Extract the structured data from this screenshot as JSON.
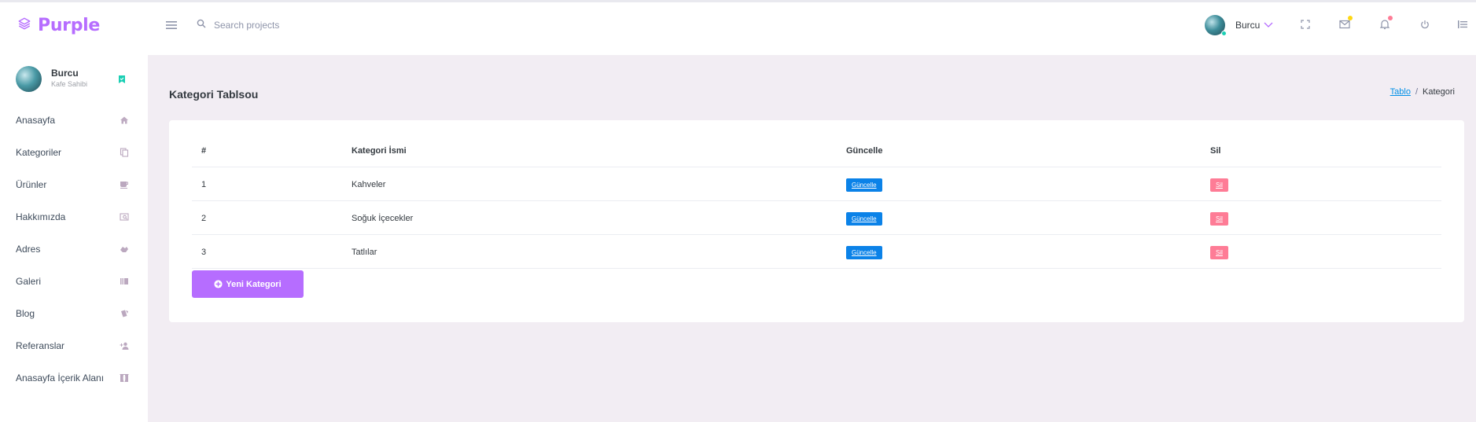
{
  "brand": {
    "name": "Purple",
    "color": "#b66dff"
  },
  "search": {
    "placeholder": "Search projects"
  },
  "navbar": {
    "username": "Burcu",
    "icons": [
      "menu-icon",
      "search-icon",
      "chevron-down-icon",
      "fullscreen-icon",
      "mail-icon",
      "bell-icon",
      "power-icon",
      "format-list-icon"
    ]
  },
  "sidebar": {
    "profile": {
      "name": "Burcu",
      "role": "Kafe Sahibi"
    },
    "items": [
      {
        "label": "Anasayfa",
        "icon": "home-icon"
      },
      {
        "label": "Kategoriler",
        "icon": "copy-icon"
      },
      {
        "label": "Ürünler",
        "icon": "coffee-icon"
      },
      {
        "label": "Hakkımızda",
        "icon": "image-search-icon"
      },
      {
        "label": "Adres",
        "icon": "hand-pointer-icon"
      },
      {
        "label": "Galeri",
        "icon": "gallery-icon"
      },
      {
        "label": "Blog",
        "icon": "cards-icon"
      },
      {
        "label": "Referanslar",
        "icon": "user-plus-icon"
      },
      {
        "label": "Anasayfa İçerik Alanı",
        "icon": "curtains-icon"
      }
    ]
  },
  "page": {
    "title": "Kategori Tablsou",
    "breadcrumb": {
      "link": "Tablo",
      "separator": "/",
      "current": "Kategori"
    }
  },
  "table": {
    "headers": [
      "#",
      "Kategori İsmi",
      "Güncelle",
      "Sil"
    ],
    "rows": [
      {
        "id": "1",
        "name": "Kahveler",
        "update_label": "Güncelle",
        "delete_label": "Sil"
      },
      {
        "id": "2",
        "name": "Soğuk İçecekler",
        "update_label": "Güncelle",
        "delete_label": "Sil"
      },
      {
        "id": "3",
        "name": "Tatlılar",
        "update_label": "Güncelle",
        "delete_label": "Sil"
      }
    ]
  },
  "new_category_button": {
    "label": "Yeni Kategori"
  },
  "colors": {
    "accent": "#b66dff",
    "update": "#0b82e8",
    "delete": "#fe7c96",
    "background": "#f2edf3",
    "online": "#1bcfb4"
  }
}
